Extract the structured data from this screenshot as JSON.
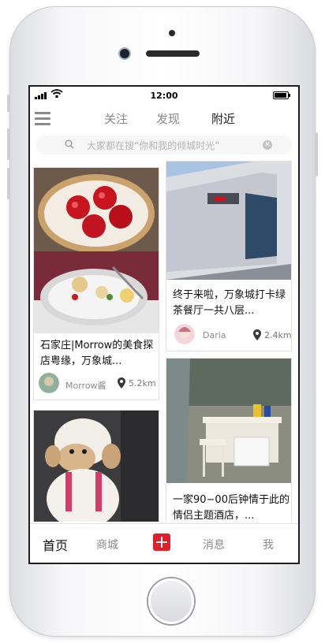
{
  "status": {
    "time": "12:00"
  },
  "top_tabs": [
    {
      "label": "关注"
    },
    {
      "label": "发现"
    },
    {
      "label": "附近"
    }
  ],
  "search": {
    "placeholder": "大家都在搜“你和我的倾城时光”"
  },
  "cards": [
    {
      "title": "石家庄|Morrow的美食探店粤缘，万象城...",
      "author": "Morrow酱",
      "distance": "5.2km"
    },
    {
      "title": "终于来啦，万象城打卡绿茶餐厅一共八层...",
      "author": "Daria",
      "distance": "2.4km"
    },
    {
      "title": "一家90−00后钟情于此的情侣主题酒店，..."
    },
    {
      "title": ""
    }
  ],
  "bottom_nav": [
    {
      "label": "首页"
    },
    {
      "label": "商城"
    },
    {
      "label": "消息"
    },
    {
      "label": "我"
    }
  ],
  "colors": {
    "accent": "#e01f2a"
  }
}
